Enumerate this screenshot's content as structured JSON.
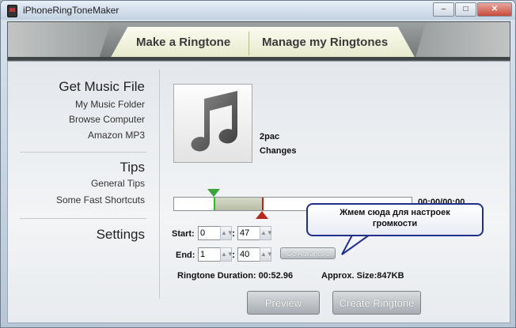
{
  "window": {
    "title": "iPhoneRingToneMaker",
    "minimize": "–",
    "maximize": "□",
    "close": "✕"
  },
  "tabs": [
    {
      "label": "Make a Ringtone",
      "active": true
    },
    {
      "label": "Manage my Ringtones",
      "active": false
    }
  ],
  "sidebar": {
    "get_music": {
      "title": "Get Music File",
      "items": [
        "My Music Folder",
        "Browse Computer",
        "Amazon MP3"
      ]
    },
    "tips": {
      "title": "Tips",
      "items": [
        "General Tips",
        "Some Fast Shortcuts"
      ]
    },
    "settings": {
      "title": "Settings"
    }
  },
  "track": {
    "artist": "2pac",
    "title": "Changes",
    "time_readout": "00:00/00:00",
    "selection_start_fraction": 0.167,
    "selection_end_fraction": 0.37
  },
  "start": {
    "label": "Start:",
    "minutes": "0",
    "seconds": "47"
  },
  "end": {
    "label": "End:",
    "minutes": "1",
    "seconds": "40"
  },
  "go_advanced_label": "Go Advanced",
  "callout": {
    "text_line1": "Жмем сюда для настроек",
    "text_line2": "громкости"
  },
  "info": {
    "duration": "Ringtone Duration:  00:52.96",
    "size": "Approx. Size:847KB"
  },
  "buttons": {
    "preview": "Preview",
    "create": "Create Ringtone"
  },
  "colors": {
    "start_marker": "#3aa33a",
    "end_marker": "#b52a1f",
    "callout_border": "#1f2f8a"
  },
  "icons": {
    "app": "phone-icon",
    "album_art": "music-note-icon"
  }
}
